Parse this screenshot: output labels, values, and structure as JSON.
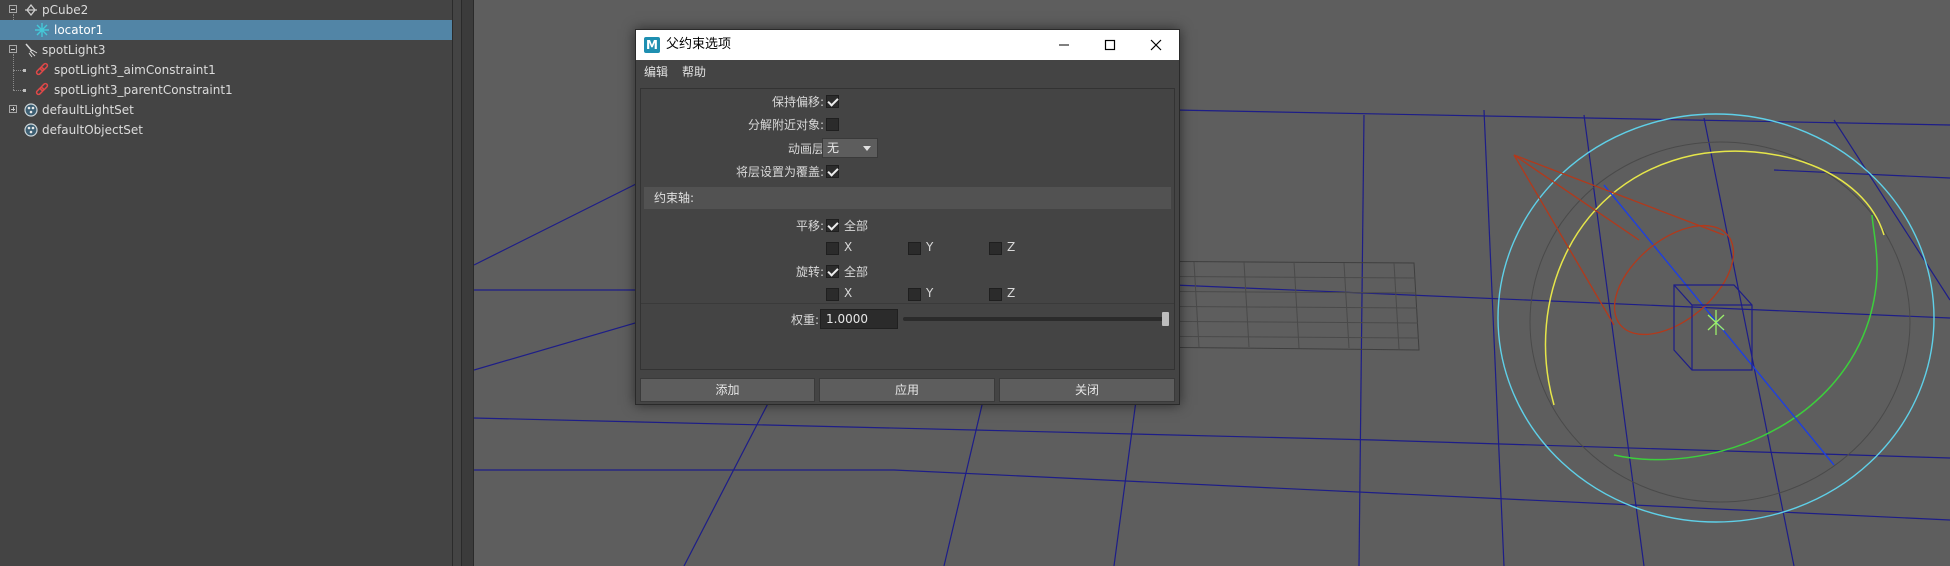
{
  "outliner": {
    "items": [
      {
        "label": "pCube2",
        "icon": "transform-icon"
      },
      {
        "label": "locator1",
        "icon": "locator-icon",
        "selected": true
      },
      {
        "label": "spotLight3",
        "icon": "spotlight-icon"
      },
      {
        "label": "spotLight3_aimConstraint1",
        "icon": "constraint-icon"
      },
      {
        "label": "spotLight3_parentConstraint1",
        "icon": "constraint-icon"
      },
      {
        "label": "defaultLightSet",
        "icon": "set-icon"
      },
      {
        "label": "defaultObjectSet",
        "icon": "set-icon"
      }
    ]
  },
  "dialog": {
    "title": "父约束选项",
    "app_icon": "M",
    "menu": [
      "编辑",
      "帮助"
    ],
    "maintain_offset": {
      "label": "保持偏移:",
      "checked": true
    },
    "decompose_nearest": {
      "label": "分解附近对象:",
      "checked": false
    },
    "anim_layer": {
      "label": "动画层",
      "value": "无"
    },
    "set_layer_override": {
      "label": "将层设置为覆盖:",
      "checked": true
    },
    "constraint_axes_header": "约束轴:",
    "translate": {
      "label": "平移:",
      "all_label": "全部",
      "all_checked": true,
      "x": "X",
      "y": "Y",
      "z": "Z"
    },
    "rotate": {
      "label": "旋转:",
      "all_label": "全部",
      "all_checked": true,
      "x": "X",
      "y": "Y",
      "z": "Z"
    },
    "weight": {
      "label": "权重:",
      "value": "1.0000",
      "slider_fraction": 1.0
    },
    "buttons": {
      "add": "添加",
      "apply": "应用",
      "close": "关闭"
    }
  },
  "colors": {
    "selection": "#5285a6",
    "grid_lines": "#1d1d88",
    "outer_ring": "#5fd0e8",
    "yellow_arc": "#e6e64a",
    "green_arc": "#3ccf3c",
    "spotlight_red": "#b3391b"
  }
}
